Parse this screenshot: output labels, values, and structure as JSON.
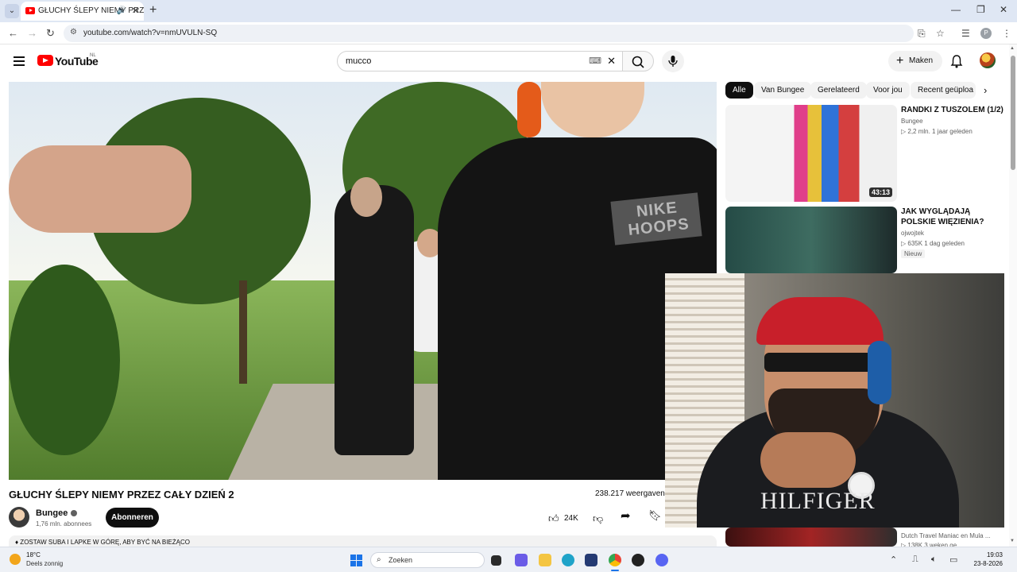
{
  "browser": {
    "tab_title": "GŁUCHY ŚLEPY NIEMY PRZE",
    "url": "youtube.com/watch?v=nmUVULN-SQ"
  },
  "youtube": {
    "logo_text": "YouTube",
    "region": "NL",
    "search_value": "mucco",
    "create_label": "Maken"
  },
  "video": {
    "title": "GŁUCHY ŚLEPY NIEMY PRZEZ CAŁY DZIEŃ 2",
    "views": "238.217 weergaven",
    "shirt_text": "NIKE HOOPS",
    "channel": "Bungee",
    "subscribers": "1,76 mln. abonnees",
    "subscribe_label": "Abonneren",
    "likes": "24K",
    "description_preview": "♦ ZOSTAW SUBA I LAPKE W GÓRĘ, ABY BYĆ NA BIEŻĄCO"
  },
  "chips": [
    "Alle",
    "Van Bungee",
    "Gerelateerd",
    "Voor jou",
    "Recent geüploa"
  ],
  "recommendations": [
    {
      "title": "RANDKI Z TUSZOLEM (1/2)",
      "channel": "Bungee",
      "meta": "▷ 2,2 mln.  1 jaar geleden",
      "duration": "43:13"
    },
    {
      "title": "JAK WYGLĄDAJĄ POLSKIE WIĘZIENIA?",
      "channel": "ojwojtek",
      "meta": "▷ 635K  1 dag geleden",
      "badge": "Nieuw"
    },
    {
      "channel": "Dutch Travel Maniac",
      "extra": "en Mula ...",
      "meta": "▷ 138K  3 weken ge..."
    }
  ],
  "webcam": {
    "shirt_text": "HILFIGER"
  },
  "taskbar": {
    "temperature": "18°C",
    "weather": "Deels zonnig",
    "search_placeholder": "Zoeken",
    "time": "19:03",
    "date": "23-8-2026"
  }
}
